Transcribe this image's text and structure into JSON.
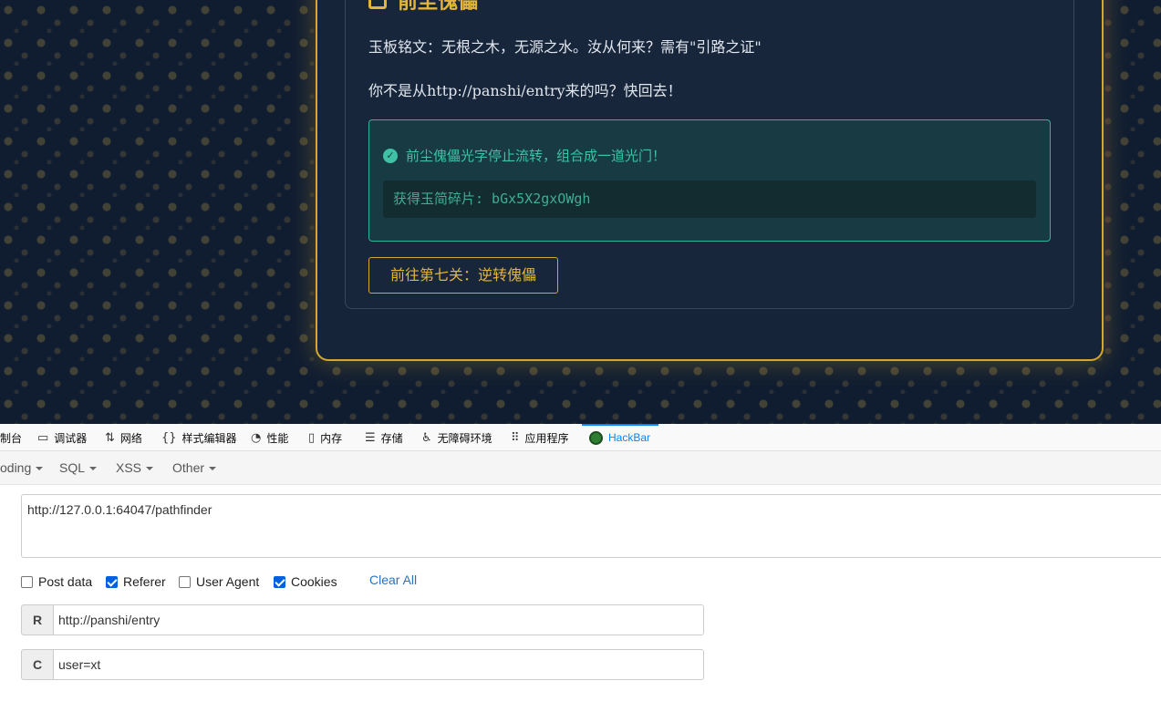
{
  "page": {
    "level_title": "前尘傀儡",
    "inscription": "玉板铭文：无根之木，无源之水。汝从何来？需有\"引路之证\"",
    "scolding": "你不是从http://panshi/entry来的吗？快回去！",
    "success_message": "前尘傀儡光字停止流转，组合成一道光门！",
    "fragment": "获得玉简碎片: bGx5X2gxOWgh",
    "next_button": "前往第七关：逆转傀儡",
    "accent_gold": "#d4a82a",
    "success_teal": "#3fc1a5"
  },
  "devtools": {
    "tabs": [
      {
        "label": "制台",
        "icon": "console-icon"
      },
      {
        "label": "调试器",
        "icon": "debugger-icon"
      },
      {
        "label": "网络",
        "icon": "network-icon"
      },
      {
        "label": "样式编辑器",
        "icon": "style-editor-icon"
      },
      {
        "label": "性能",
        "icon": "performance-icon"
      },
      {
        "label": "内存",
        "icon": "memory-icon"
      },
      {
        "label": "存储",
        "icon": "storage-icon"
      },
      {
        "label": "无障碍环境",
        "icon": "accessibility-icon"
      },
      {
        "label": "应用程序",
        "icon": "application-icon"
      },
      {
        "label": "HackBar",
        "icon": "hackbar-icon",
        "active": true
      }
    ]
  },
  "hackbar": {
    "menu": [
      "oding",
      "SQL",
      "XSS",
      "Other"
    ],
    "url": "http://127.0.0.1:64047/pathfinder",
    "options": [
      {
        "label": "Post data",
        "checked": false
      },
      {
        "label": "Referer",
        "checked": true
      },
      {
        "label": "User Agent",
        "checked": false
      },
      {
        "label": "Cookies",
        "checked": true
      }
    ],
    "clear_all": "Clear All",
    "referer": {
      "label": "R",
      "value": "http://panshi/entry"
    },
    "cookies": {
      "label": "C",
      "value": "user=xt"
    }
  }
}
